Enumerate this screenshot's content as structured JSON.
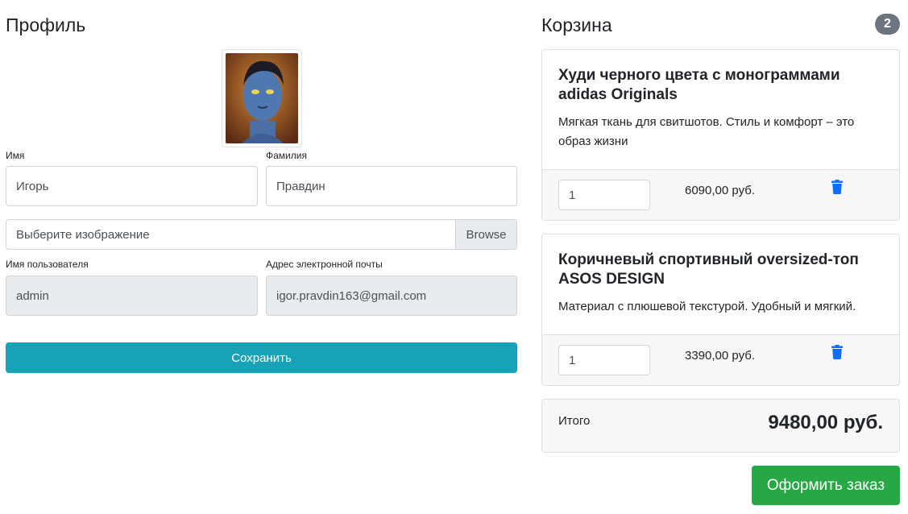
{
  "profile": {
    "title": "Профиль",
    "first_name_label": "Имя",
    "first_name_value": "Игорь",
    "last_name_label": "Фамилия",
    "last_name_value": "Правдин",
    "file_placeholder": "Выберите изображение",
    "file_browse_label": "Browse",
    "username_label": "Имя пользователя",
    "username_value": "admin",
    "email_label": "Адрес электронной почты",
    "email_value": "igor.pravdin163@gmail.com",
    "save_label": "Сохранить"
  },
  "cart": {
    "title": "Корзина",
    "count": "2",
    "items": [
      {
        "name": "Худи черного цвета с монограммами adidas Originals",
        "description": "Мягкая ткань для свитшотов. Стиль и комфорт – это образ жизни",
        "quantity": "1",
        "price": "6090,00 руб."
      },
      {
        "name": "Коричневый спортивный oversized-топ ASOS DESIGN",
        "description": "Материал с плюшевой текстурой. Удобный и мягкий.",
        "quantity": "1",
        "price": "3390,00 руб."
      }
    ],
    "total_label": "Итого",
    "total_value": "9480,00 руб.",
    "order_label": "Оформить заказ"
  },
  "colors": {
    "accent_info": "#17a2b8",
    "accent_success": "#28a745",
    "badge": "#6c757d",
    "trash_icon": "#0d6efd"
  }
}
